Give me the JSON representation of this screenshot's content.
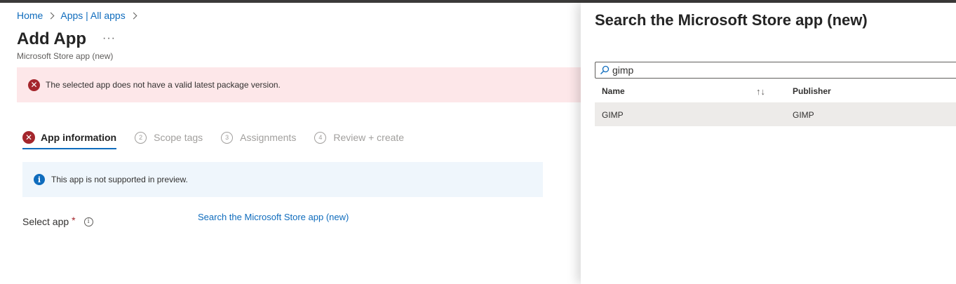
{
  "breadcrumb": [
    {
      "label": "Home"
    },
    {
      "label": "Apps | All apps"
    }
  ],
  "page": {
    "title": "Add App",
    "more": "···",
    "subtitle": "Microsoft Store app (new)"
  },
  "error_banner": {
    "icon": "error-circle-icon",
    "message": "The selected app does not have a valid latest package version."
  },
  "steps": [
    {
      "num": "",
      "label": "App information",
      "state": "error"
    },
    {
      "num": "2",
      "label": "Scope tags",
      "state": "pending"
    },
    {
      "num": "3",
      "label": "Assignments",
      "state": "pending"
    },
    {
      "num": "4",
      "label": "Review + create",
      "state": "pending"
    }
  ],
  "info_banner": {
    "icon": "info-icon",
    "message": "This app is not supported in preview."
  },
  "form": {
    "select_app_label": "Select app",
    "required_mark": "*",
    "search_link": "Search the Microsoft Store app (new)"
  },
  "panel": {
    "title": "Search the Microsoft Store app (new)",
    "search_value": "gimp",
    "columns": {
      "name": "Name",
      "publisher": "Publisher",
      "sort_icon": "↑↓"
    },
    "rows": [
      {
        "name": "GIMP",
        "publisher": "GIMP"
      }
    ]
  },
  "colors": {
    "link": "#0f6cbd",
    "error": "#a4262c",
    "error_bg": "#fde7e9",
    "info_bg": "#eff6fc",
    "selected_row": "#edebe9"
  }
}
